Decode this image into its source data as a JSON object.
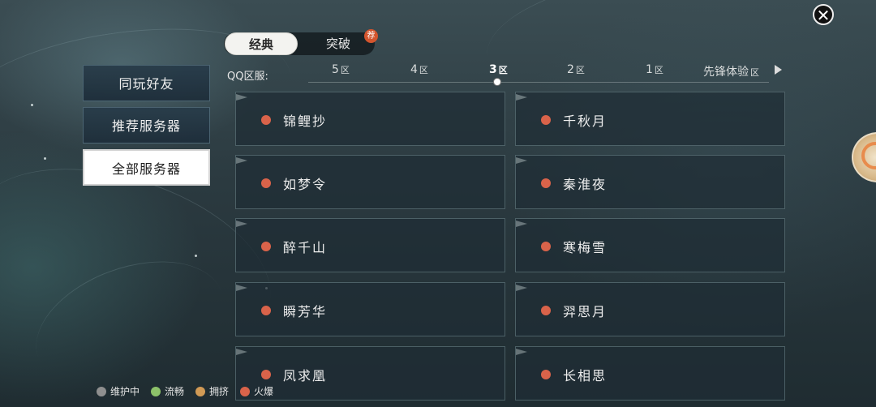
{
  "close": {
    "icon": "close-icon",
    "glyph": "✕"
  },
  "mode_tabs": {
    "classic": "经典",
    "breakthrough": "突破",
    "badge": "荐"
  },
  "zones": {
    "label": "QQ区服:",
    "tabs": [
      {
        "num": "5",
        "suffix": "区",
        "active": false
      },
      {
        "num": "4",
        "suffix": "区",
        "active": false
      },
      {
        "num": "3",
        "suffix": "区",
        "active": true
      },
      {
        "num": "2",
        "suffix": "区",
        "active": false
      },
      {
        "num": "1",
        "suffix": "区",
        "active": false
      },
      {
        "num": "先锋体验",
        "suffix": "区",
        "active": false
      }
    ]
  },
  "sidebar": {
    "items": [
      {
        "label": "同玩好友",
        "active": false
      },
      {
        "label": "推荐服务器",
        "active": false
      },
      {
        "label": "全部服务器",
        "active": true
      }
    ]
  },
  "status_colors": {
    "maintenance": "#8f8f8f",
    "smooth": "#8dc26a",
    "crowded": "#d19a55",
    "hot": "#d9634a"
  },
  "servers": [
    {
      "name": "锦鲤抄",
      "status": "hot"
    },
    {
      "name": "千秋月",
      "status": "hot"
    },
    {
      "name": "如梦令",
      "status": "hot"
    },
    {
      "name": "秦淮夜",
      "status": "hot"
    },
    {
      "name": "醉千山",
      "status": "hot"
    },
    {
      "name": "寒梅雪",
      "status": "hot"
    },
    {
      "name": "瞬芳华",
      "status": "hot"
    },
    {
      "name": "羿思月",
      "status": "hot"
    },
    {
      "name": "凤求凰",
      "status": "hot"
    },
    {
      "name": "长相思",
      "status": "hot"
    }
  ],
  "legend": [
    {
      "label": "维护中",
      "status": "maintenance"
    },
    {
      "label": "流畅",
      "status": "smooth"
    },
    {
      "label": "拥挤",
      "status": "crowded"
    },
    {
      "label": "火爆",
      "status": "hot"
    }
  ]
}
